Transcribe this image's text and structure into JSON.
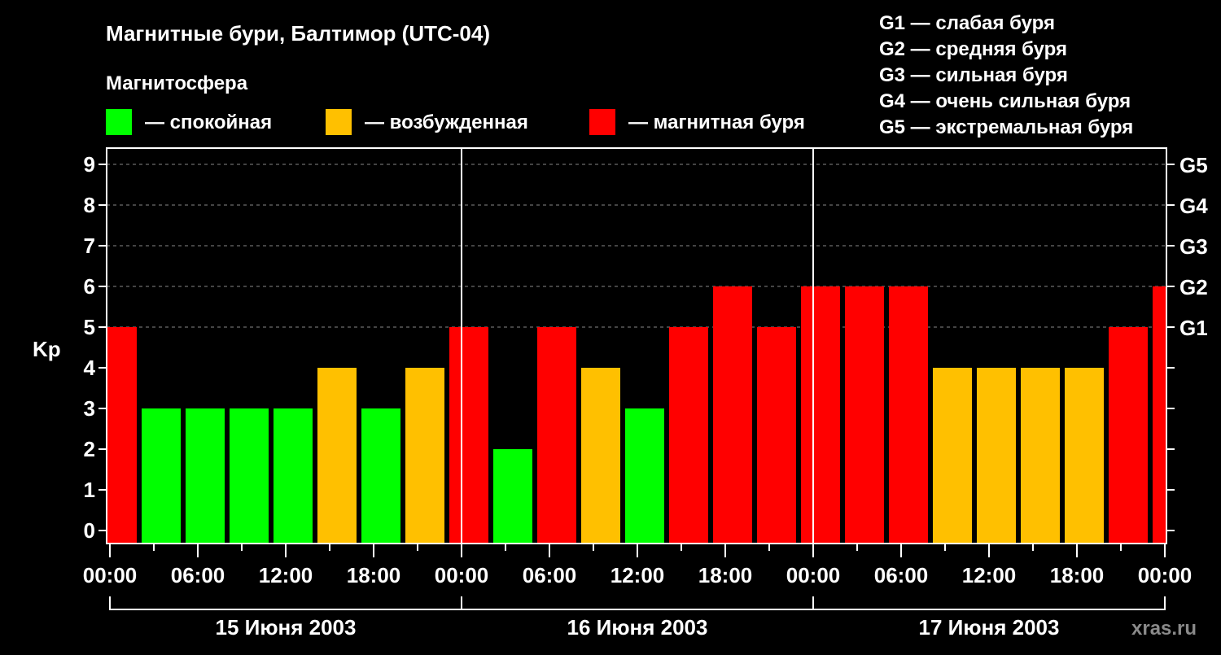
{
  "title": "Магнитные бури, Балтимор (UTC-04)",
  "legend": {
    "heading": "Магнитосфера",
    "items": [
      {
        "label": "— спокойная",
        "color": "#00ff00"
      },
      {
        "label": "— возбужденная",
        "color": "#ffc000"
      },
      {
        "label": "— магнитная буря",
        "color": "#ff0000"
      }
    ]
  },
  "g_scale": [
    "G1 — слабая буря",
    "G2 — средняя буря",
    "G3 — сильная буря",
    "G4 — очень сильная буря",
    "G5 — экстремальная буря"
  ],
  "watermark": "xras.ru",
  "chart_data": {
    "type": "bar",
    "title": "Магнитные бури, Балтимор (UTC-04)",
    "ylabel": "Kp",
    "ylim": [
      0,
      9
    ],
    "yticks": [
      "0",
      "1",
      "2",
      "3",
      "4",
      "5",
      "6",
      "7",
      "8",
      "9"
    ],
    "right_ticks": [
      {
        "value": 5,
        "label": "G1"
      },
      {
        "value": 6,
        "label": "G2"
      },
      {
        "value": 7,
        "label": "G3"
      },
      {
        "value": 8,
        "label": "G4"
      },
      {
        "value": 9,
        "label": "G5"
      }
    ],
    "x_range_hours": [
      0,
      72
    ],
    "xticks": [
      "00:00",
      "06:00",
      "12:00",
      "18:00",
      "00:00",
      "06:00",
      "12:00",
      "18:00",
      "00:00",
      "06:00",
      "12:00",
      "18:00",
      "00:00"
    ],
    "days": [
      "15 Июня 2003",
      "16 Июня 2003",
      "17 Июня 2003"
    ],
    "grid": "dashed horizontal at 5-9",
    "bars": [
      {
        "start": 0,
        "end": 2,
        "kp": 5
      },
      {
        "start": 2,
        "end": 5,
        "kp": 3
      },
      {
        "start": 5,
        "end": 8,
        "kp": 3
      },
      {
        "start": 8,
        "end": 11,
        "kp": 3
      },
      {
        "start": 11,
        "end": 14,
        "kp": 3
      },
      {
        "start": 14,
        "end": 17,
        "kp": 4
      },
      {
        "start": 17,
        "end": 20,
        "kp": 3
      },
      {
        "start": 20,
        "end": 23,
        "kp": 4
      },
      {
        "start": 23,
        "end": 26,
        "kp": 5
      },
      {
        "start": 26,
        "end": 29,
        "kp": 2
      },
      {
        "start": 29,
        "end": 32,
        "kp": 5
      },
      {
        "start": 32,
        "end": 35,
        "kp": 4
      },
      {
        "start": 35,
        "end": 38,
        "kp": 3
      },
      {
        "start": 38,
        "end": 41,
        "kp": 5
      },
      {
        "start": 41,
        "end": 44,
        "kp": 6
      },
      {
        "start": 44,
        "end": 47,
        "kp": 5
      },
      {
        "start": 47,
        "end": 50,
        "kp": 6
      },
      {
        "start": 50,
        "end": 53,
        "kp": 6
      },
      {
        "start": 53,
        "end": 56,
        "kp": 6
      },
      {
        "start": 56,
        "end": 59,
        "kp": 4
      },
      {
        "start": 59,
        "end": 62,
        "kp": 4
      },
      {
        "start": 62,
        "end": 65,
        "kp": 4
      },
      {
        "start": 65,
        "end": 68,
        "kp": 4
      },
      {
        "start": 68,
        "end": 71,
        "kp": 5
      },
      {
        "start": 71,
        "end": 72,
        "kp": 6
      }
    ],
    "colors": {
      "quiet": "#00ff00",
      "active": "#ffc000",
      "storm": "#ff0000"
    }
  }
}
